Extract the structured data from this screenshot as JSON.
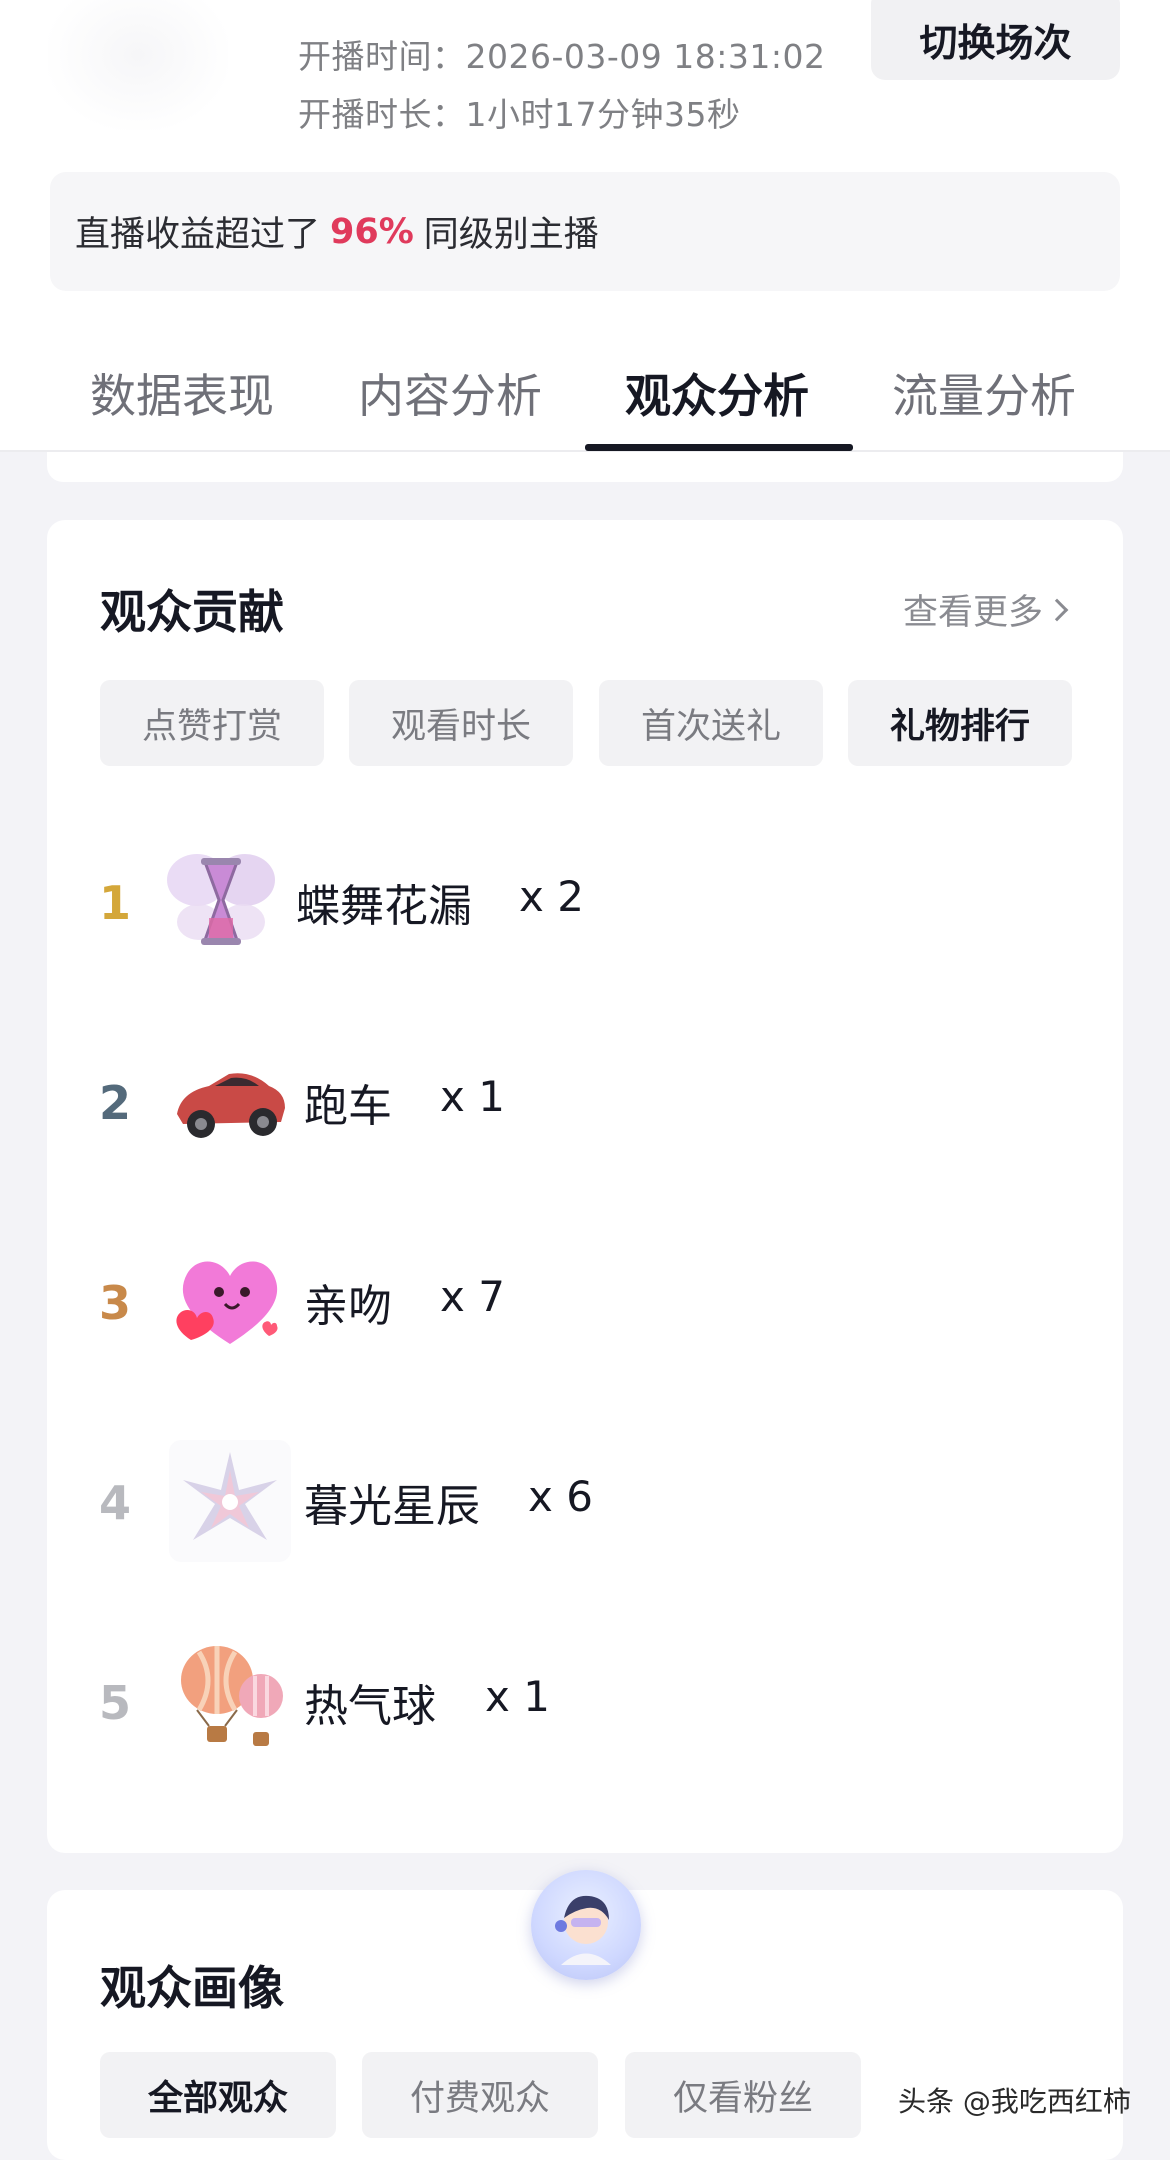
{
  "header": {
    "start_time": "开播时间：2026-03-09 18:31:02",
    "duration": "开播时长：1小时17分钟35秒",
    "switch_button": "切换场次"
  },
  "earnings": {
    "prefix": "直播收益超过了",
    "percent": "96%",
    "suffix": "同级别主播"
  },
  "tabs": [
    {
      "label": "数据表现",
      "active": false
    },
    {
      "label": "内容分析",
      "active": false
    },
    {
      "label": "观众分析",
      "active": true
    },
    {
      "label": "流量分析",
      "active": false
    }
  ],
  "contribution": {
    "title": "观众贡献",
    "more": "查看更多",
    "chips": [
      {
        "label": "点赞打赏",
        "active": false
      },
      {
        "label": "观看时长",
        "active": false
      },
      {
        "label": "首次送礼",
        "active": false
      },
      {
        "label": "礼物排行",
        "active": true
      }
    ],
    "gifts": [
      {
        "rank": "1",
        "name": "蝶舞花漏",
        "count": "x 2",
        "rank_color": "#d4a73a",
        "icon": "butterfly-hourglass-icon"
      },
      {
        "rank": "2",
        "name": "跑车",
        "count": "x 1",
        "rank_color": "#546a7b",
        "icon": "sports-car-icon"
      },
      {
        "rank": "3",
        "name": "亲吻",
        "count": "x 7",
        "rank_color": "#c8894a",
        "icon": "heart-kiss-icon"
      },
      {
        "rank": "4",
        "name": "暮光星辰",
        "count": "x 6",
        "rank_color": "#b8b9be",
        "icon": "twilight-star-icon"
      },
      {
        "rank": "5",
        "name": "热气球",
        "count": "x 1",
        "rank_color": "#b8b9be",
        "icon": "hot-air-balloon-icon"
      }
    ]
  },
  "portrait": {
    "title": "观众画像",
    "chips": [
      {
        "label": "全部观众",
        "active": true
      },
      {
        "label": "付费观众",
        "active": false
      },
      {
        "label": "仅看粉丝",
        "active": false
      }
    ]
  },
  "watermark": "头条 @我吃西红柿"
}
